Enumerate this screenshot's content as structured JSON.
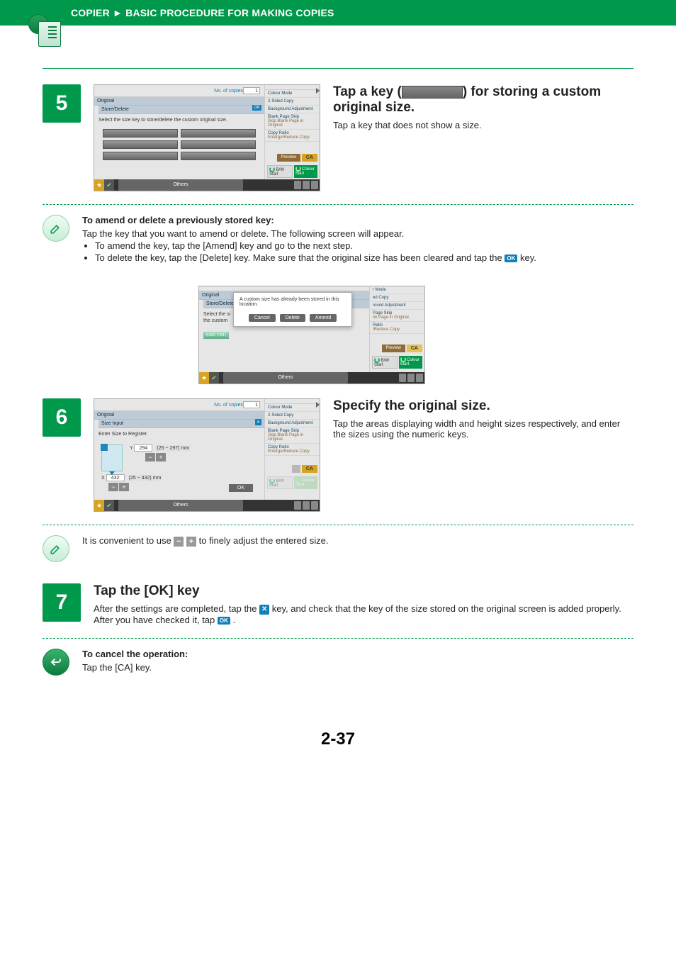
{
  "breadcrumb_left": "COPIER",
  "breadcrumb_sep": "►",
  "breadcrumb_right": "BASIC PROCEDURE FOR MAKING COPIES",
  "common_mock": {
    "no_of_copies_label": "No. of copies",
    "no_of_copies_value": "1",
    "right_panel": {
      "colour_mode": "Colour Mode",
      "two_sided": "2-Sided Copy",
      "bg_adj": "Background Adjustment",
      "blank_skip": "Blank Page Skip",
      "blank_skip_sub": "Skip Blank Page in Original",
      "copy_ratio": "Copy Ratio",
      "copy_ratio_sub": "Enlarge/Reduce Copy",
      "preview": "Preview",
      "ca": "CA",
      "bw_start": "B/W\nStart",
      "colour_start": "Colour\nStart"
    },
    "footer_others": "Others",
    "ok_chip": "OK"
  },
  "step5": {
    "number": "5",
    "title_pre": "Tap a key (",
    "title_post": ") for storing a custom original size.",
    "desc": "Tap a key that does not show a size.",
    "mock_breadcrumb1": "Original",
    "mock_breadcrumb2": "Store/Delete",
    "mock_instruction": "Select the size key to store/delete the custom original size."
  },
  "hint_amend": {
    "title": "To amend or delete a previously stored key:",
    "line1": "Tap the key that you want to amend or delete. The following screen will appear.",
    "bullet1": "To amend the key, tap the [Amend] key and go to the next step.",
    "bullet2_pre": "To delete the key, tap the [Delete] key. Make sure that the original size has been cleared and tap the ",
    "bullet2_post": " key.",
    "mock": {
      "msg": "A custom size has already been stored in this location.",
      "stored": "X420 Y297",
      "cancel": "Cancel",
      "delete": "Delete",
      "amend": "Amend",
      "r1": "r Mode",
      "r2": "ed Copy",
      "r3": "round Adjustment",
      "r4": "Page Skip",
      "r4s": "nk Page in Original",
      "r5": "Ratio",
      "r5s": "/Reduce Copy"
    }
  },
  "step6": {
    "number": "6",
    "title": "Specify the original size.",
    "desc": "Tap the areas displaying width and height sizes respectively, and enter the sizes using the numeric keys.",
    "mock_breadcrumb1": "Original",
    "mock_breadcrumb2": "Size Input",
    "mock_instruction": "Enter Size to Register.",
    "y_label": "Y",
    "y_value": "294",
    "y_range": "(25 ~ 297) mm",
    "x_label": "X",
    "x_value": "432",
    "x_range": "(25 ~ 432) mm",
    "ok": "OK"
  },
  "hint_pm": {
    "pre": "It is convenient to use ",
    "post": " to finely adjust the entered size.",
    "minus": "−",
    "plus": "+"
  },
  "step7": {
    "number": "7",
    "title": "Tap the [OK] key",
    "line_pre": "After the settings are completed, tap the ",
    "line_mid": " key, and check that the key of the size stored on the original screen is added properly. After you have checked it, tap ",
    "line_post": " ."
  },
  "hint_cancel": {
    "title": "To cancel the operation:",
    "line": "Tap the [CA] key."
  },
  "page_number": "2-37"
}
